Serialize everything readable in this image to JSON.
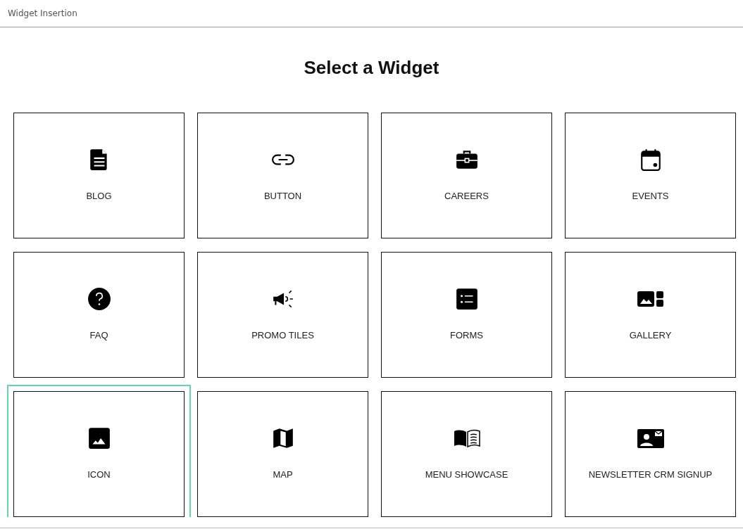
{
  "header": {
    "title": "Widget Insertion"
  },
  "heading": "Select a Widget",
  "widgets": [
    {
      "kind": "blog",
      "label": "BLOG",
      "selected": false
    },
    {
      "kind": "button",
      "label": "BUTTON",
      "selected": false
    },
    {
      "kind": "careers",
      "label": "CAREERS",
      "selected": false
    },
    {
      "kind": "events",
      "label": "EVENTS",
      "selected": false
    },
    {
      "kind": "faq",
      "label": "FAQ",
      "selected": false
    },
    {
      "kind": "promo",
      "label": "PROMO TILES",
      "selected": false
    },
    {
      "kind": "forms",
      "label": "FORMS",
      "selected": false
    },
    {
      "kind": "gallery",
      "label": "GALLERY",
      "selected": false
    },
    {
      "kind": "icon",
      "label": "ICON",
      "selected": true
    },
    {
      "kind": "map",
      "label": "MAP",
      "selected": false
    },
    {
      "kind": "menu",
      "label": "MENU SHOWCASE",
      "selected": false
    },
    {
      "kind": "newsletter",
      "label": "NEWSLETTER CRM SIGNUP",
      "selected": false
    }
  ]
}
